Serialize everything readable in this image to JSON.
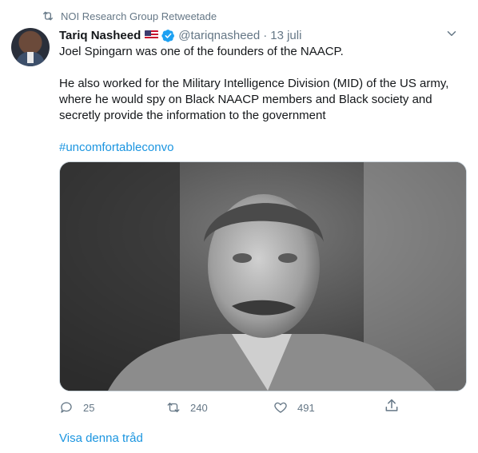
{
  "retweet": {
    "icon": "retweet-icon",
    "text": "NOI Research Group Retweetade"
  },
  "author": {
    "name": "Tariq Nasheed",
    "flag": "us-flag-icon",
    "verified": "verified-badge-icon",
    "handle": "@tariqnasheed",
    "separator": "·",
    "date": "13 juli"
  },
  "tweet": {
    "line1": "Joel Spingarn was one of the founders of the NAACP.",
    "line2": "He also worked for the Military  Intelligence Division (MID) of the US army, where he would spy on Black NAACP members and Black society and secretly provide the information to the government",
    "hashtag": "#uncomfortableconvo"
  },
  "media": {
    "icon": "photo-image"
  },
  "actions": {
    "reply_count": "25",
    "retweet_count": "240",
    "like_count": "491"
  },
  "show_thread": "Visa denna tråd",
  "colors": {
    "link": "#1b95e0",
    "muted": "#657786",
    "text": "#14171a"
  }
}
